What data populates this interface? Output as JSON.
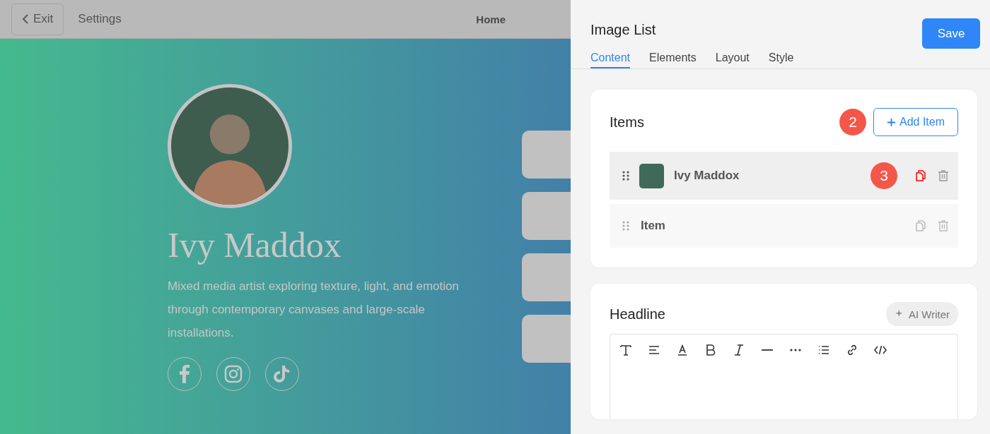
{
  "topbar": {
    "exit": "Exit",
    "settings": "Settings",
    "home": "Home"
  },
  "profile": {
    "name": "Ivy Maddox",
    "bio": "Mixed media artist exploring texture, light, and emotion through contemporary canvases and large-scale installations."
  },
  "panel": {
    "title": "Image List",
    "save": "Save",
    "tabs": [
      {
        "label": "Content",
        "selected": true
      },
      {
        "label": "Elements",
        "selected": false
      },
      {
        "label": "Layout",
        "selected": false
      },
      {
        "label": "Style",
        "selected": false
      }
    ],
    "items": {
      "title": "Items",
      "step_badge": "2",
      "add_button": "Add Item",
      "rows": [
        {
          "label": "Ivy Maddox",
          "kind": "image",
          "highlighted": true,
          "step_badge": "3"
        },
        {
          "label": "Item",
          "kind": "plain",
          "highlighted": false
        }
      ]
    },
    "headline": {
      "title": "Headline",
      "ai_writer": "AI Writer"
    }
  }
}
